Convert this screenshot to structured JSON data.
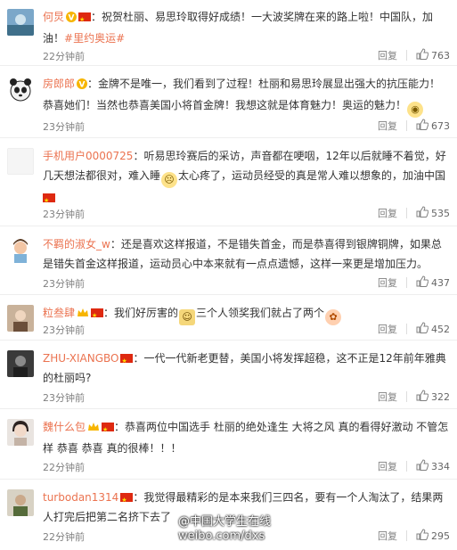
{
  "colors": {
    "username": "#eb7350",
    "meta": "#808080",
    "divider": "#eeeeee"
  },
  "icons": {
    "like": "thumbs-up-icon",
    "flag": "china-flag-icon",
    "vip": "verified-v-icon"
  },
  "reply_label": "回复",
  "comments": [
    {
      "user": "何炅",
      "sep": "：",
      "text_a": "祝贺杜丽、易思玲取得好成绩！一大波奖牌在来的路上啦！中国队，加油！",
      "topic": "#里约奥运#",
      "time": "22分钟前",
      "likes": "763"
    },
    {
      "user": "房郎郎",
      "sep": "：",
      "text_a": "金牌不是唯一，我们看到了过程！杜丽和易思玲展显出强大的抗压能力！恭喜她们！当然也恭喜美国小将首金牌！我想这就是体育魅力！奥运的魅力！",
      "time": "23分钟前",
      "likes": "673"
    },
    {
      "user": "手机用户0000725",
      "sep": "：",
      "text_a": "听易思玲赛后的采访，声音都在哽咽，12年以后就睡不着觉，好几天想法都很对，难入睡",
      "text_b": "太心疼了，运动员经受的真是常人难以想象的，加油中国",
      "time": "23分钟前",
      "likes": "535"
    },
    {
      "user": "不羁的淑女_w",
      "sep": "：",
      "text_a": "还是喜欢这样报道，不是错失首金，而是恭喜得到银牌铜牌，如果总是错失首金这样报道，运动员心中本来就有一点点遗憾，这样一来更是增加压力。",
      "time": "23分钟前",
      "likes": "437"
    },
    {
      "user": "粒叁肆",
      "sep": "：",
      "text_a": "我们好厉害的",
      "text_b": "三个人领奖我们就占了两个",
      "time": "23分钟前",
      "likes": "452"
    },
    {
      "user": "ZHU-XIANGBO",
      "sep": "：",
      "text_a": "一代一代新老更替，美国小将发挥超稳，这不正是12年前年雅典的杜丽吗?",
      "time": "23分钟前",
      "likes": "322"
    },
    {
      "user": "魏什么包",
      "sep": "：",
      "text_a": "恭喜两位中国选手 杜丽的绝处逢生 大将之风 真的看得好激动 不管怎样 恭喜 恭喜 真的很棒！！！",
      "time": "22分钟前",
      "likes": "334"
    },
    {
      "user": "turbodan1314",
      "sep": "：",
      "text_a": "我觉得最精彩的是本来我们三四名，要有一个人淘汰了，结果两人打完后把第二名挤下去了",
      "time": "22分钟前",
      "likes": "295"
    }
  ],
  "watermark": {
    "line1": "@中国大学生在线",
    "line2": "weibo.com/dxs"
  }
}
